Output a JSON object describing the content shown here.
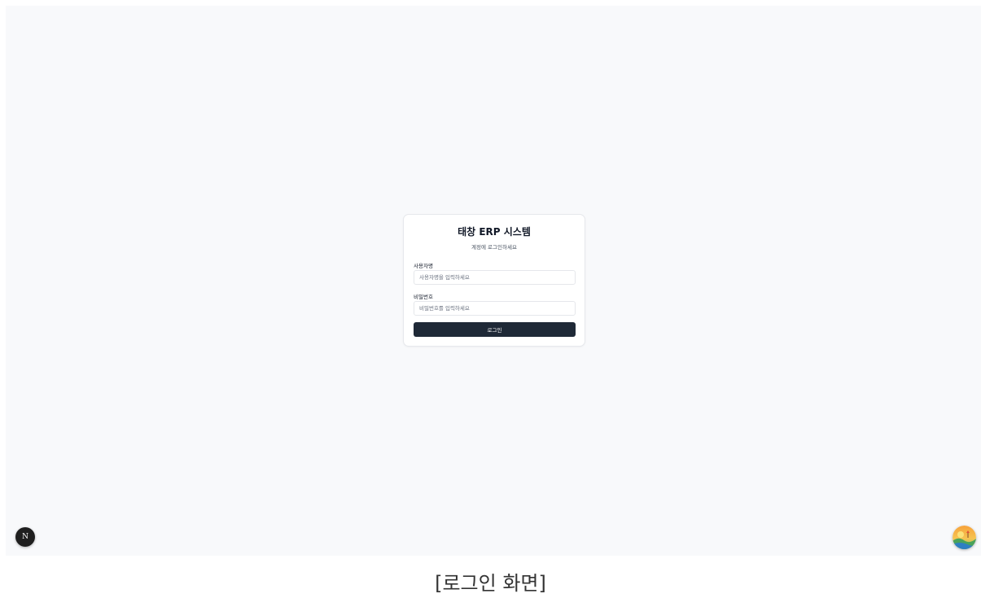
{
  "login": {
    "title": "태창 ERP 시스템",
    "subtitle": "계정에 로그인하세요",
    "username": {
      "label": "사용자명",
      "placeholder": "사용자명을 입력하세요",
      "value": ""
    },
    "password": {
      "label": "비밀번호",
      "placeholder": "비밀번호를 입력하세요",
      "value": ""
    },
    "submit_label": "로그인"
  },
  "dev_badge": {
    "letter": "N"
  },
  "caption": "[로그인 화면]",
  "colors": {
    "background": "#f8f9fb",
    "card": "#ffffff",
    "button": "#1f2937",
    "button_text": "#ffffff"
  },
  "icons": {
    "dev_badge": "nextjs-logo-icon",
    "assistant": "assistant-avatar-icon"
  }
}
